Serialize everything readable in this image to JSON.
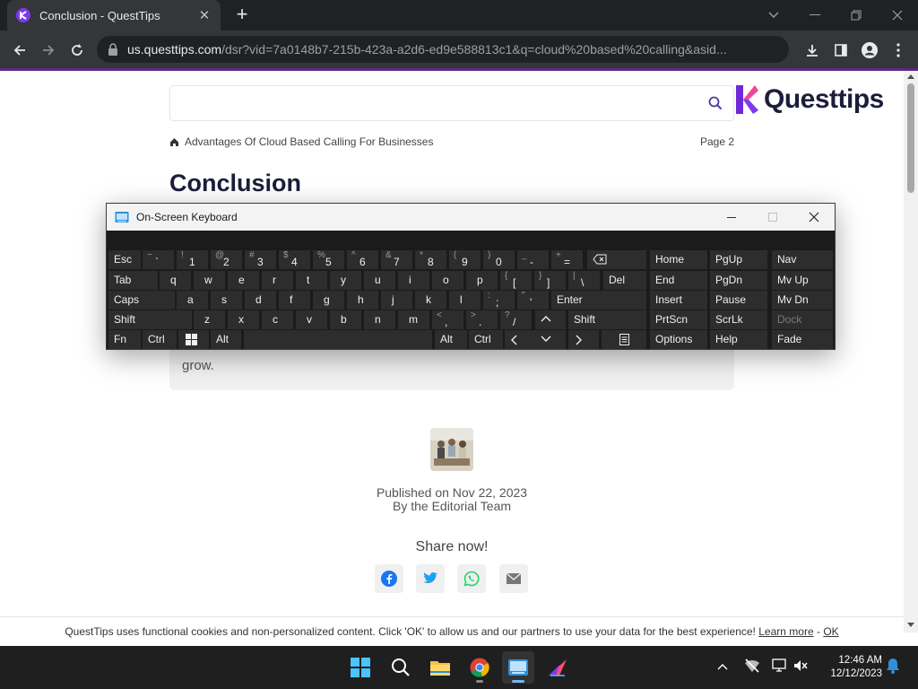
{
  "browser": {
    "tab_title": "Conclusion - QuestTips",
    "url_host": "us.questtips.com",
    "url_rest": "/dsr?vid=7a0148b7-215b-423a-a2d6-ed9e588813c1&q=cloud%20based%20calling&asid..."
  },
  "page": {
    "logo_text": "Questtips",
    "breadcrumb": "Advantages Of Cloud Based Calling For Businesses",
    "page_number": "Page 2",
    "heading": "Conclusion",
    "card_text": "grow.",
    "published": "Published on Nov 22, 2023",
    "byline": "By the Editorial Team",
    "share_label": "Share now!"
  },
  "cookie": {
    "text": "QuestTips uses functional cookies and non-personalized content. Click 'OK' to allow us and our partners to use your data for the best experience!",
    "learn_more": "Learn more",
    "separator": "-",
    "ok": "OK"
  },
  "osk": {
    "title": "On-Screen Keyboard",
    "keys": {
      "esc": "Esc",
      "tab": "Tab",
      "caps": "Caps",
      "shift": "Shift",
      "shift_r": "Shift",
      "fn": "Fn",
      "ctrl": "Ctrl",
      "ctrl_r": "Ctrl",
      "alt": "Alt",
      "alt_r": "Alt",
      "del": "Del",
      "enter": "Enter",
      "home": "Home",
      "pgup": "PgUp",
      "nav": "Nav",
      "end": "End",
      "pgdn": "PgDn",
      "mvup": "Mv Up",
      "insert": "Insert",
      "pause": "Pause",
      "mvdn": "Mv Dn",
      "prtscn": "PrtScn",
      "scrlk": "ScrLk",
      "dock": "Dock",
      "options": "Options",
      "help": "Help",
      "fade": "Fade"
    },
    "number_row": [
      {
        "top": "~",
        "main": "`"
      },
      {
        "top": "!",
        "main": "1"
      },
      {
        "top": "@",
        "main": "2"
      },
      {
        "top": "#",
        "main": "3"
      },
      {
        "top": "$",
        "main": "4"
      },
      {
        "top": "%",
        "main": "5"
      },
      {
        "top": "^",
        "main": "6"
      },
      {
        "top": "&",
        "main": "7"
      },
      {
        "top": "*",
        "main": "8"
      },
      {
        "top": "(",
        "main": "9"
      },
      {
        "top": ")",
        "main": "0"
      },
      {
        "top": "_",
        "main": "-"
      },
      {
        "top": "+",
        "main": "="
      }
    ],
    "row_q": [
      "q",
      "w",
      "e",
      "r",
      "t",
      "y",
      "u",
      "i",
      "o",
      "p"
    ],
    "row_q_extra": [
      {
        "top": "{",
        "main": "["
      },
      {
        "top": "}",
        "main": "]"
      },
      {
        "top": "|",
        "main": "\\"
      }
    ],
    "row_a": [
      "a",
      "s",
      "d",
      "f",
      "g",
      "h",
      "j",
      "k",
      "l"
    ],
    "row_a_extra": [
      {
        "top": ":",
        "main": ";"
      },
      {
        "top": "\"",
        "main": "'"
      }
    ],
    "row_z": [
      "z",
      "x",
      "c",
      "v",
      "b",
      "n",
      "m"
    ],
    "row_z_extra": [
      {
        "top": "<",
        "main": ","
      },
      {
        "top": ">",
        "main": "."
      },
      {
        "top": "?",
        "main": "/"
      }
    ]
  },
  "taskbar": {
    "time": "12:46 AM",
    "date": "12/12/2023"
  },
  "colors": {
    "accent_purple": "#5b2a86",
    "chrome_dark": "#202124",
    "osk_key": "#2d2d2d"
  }
}
